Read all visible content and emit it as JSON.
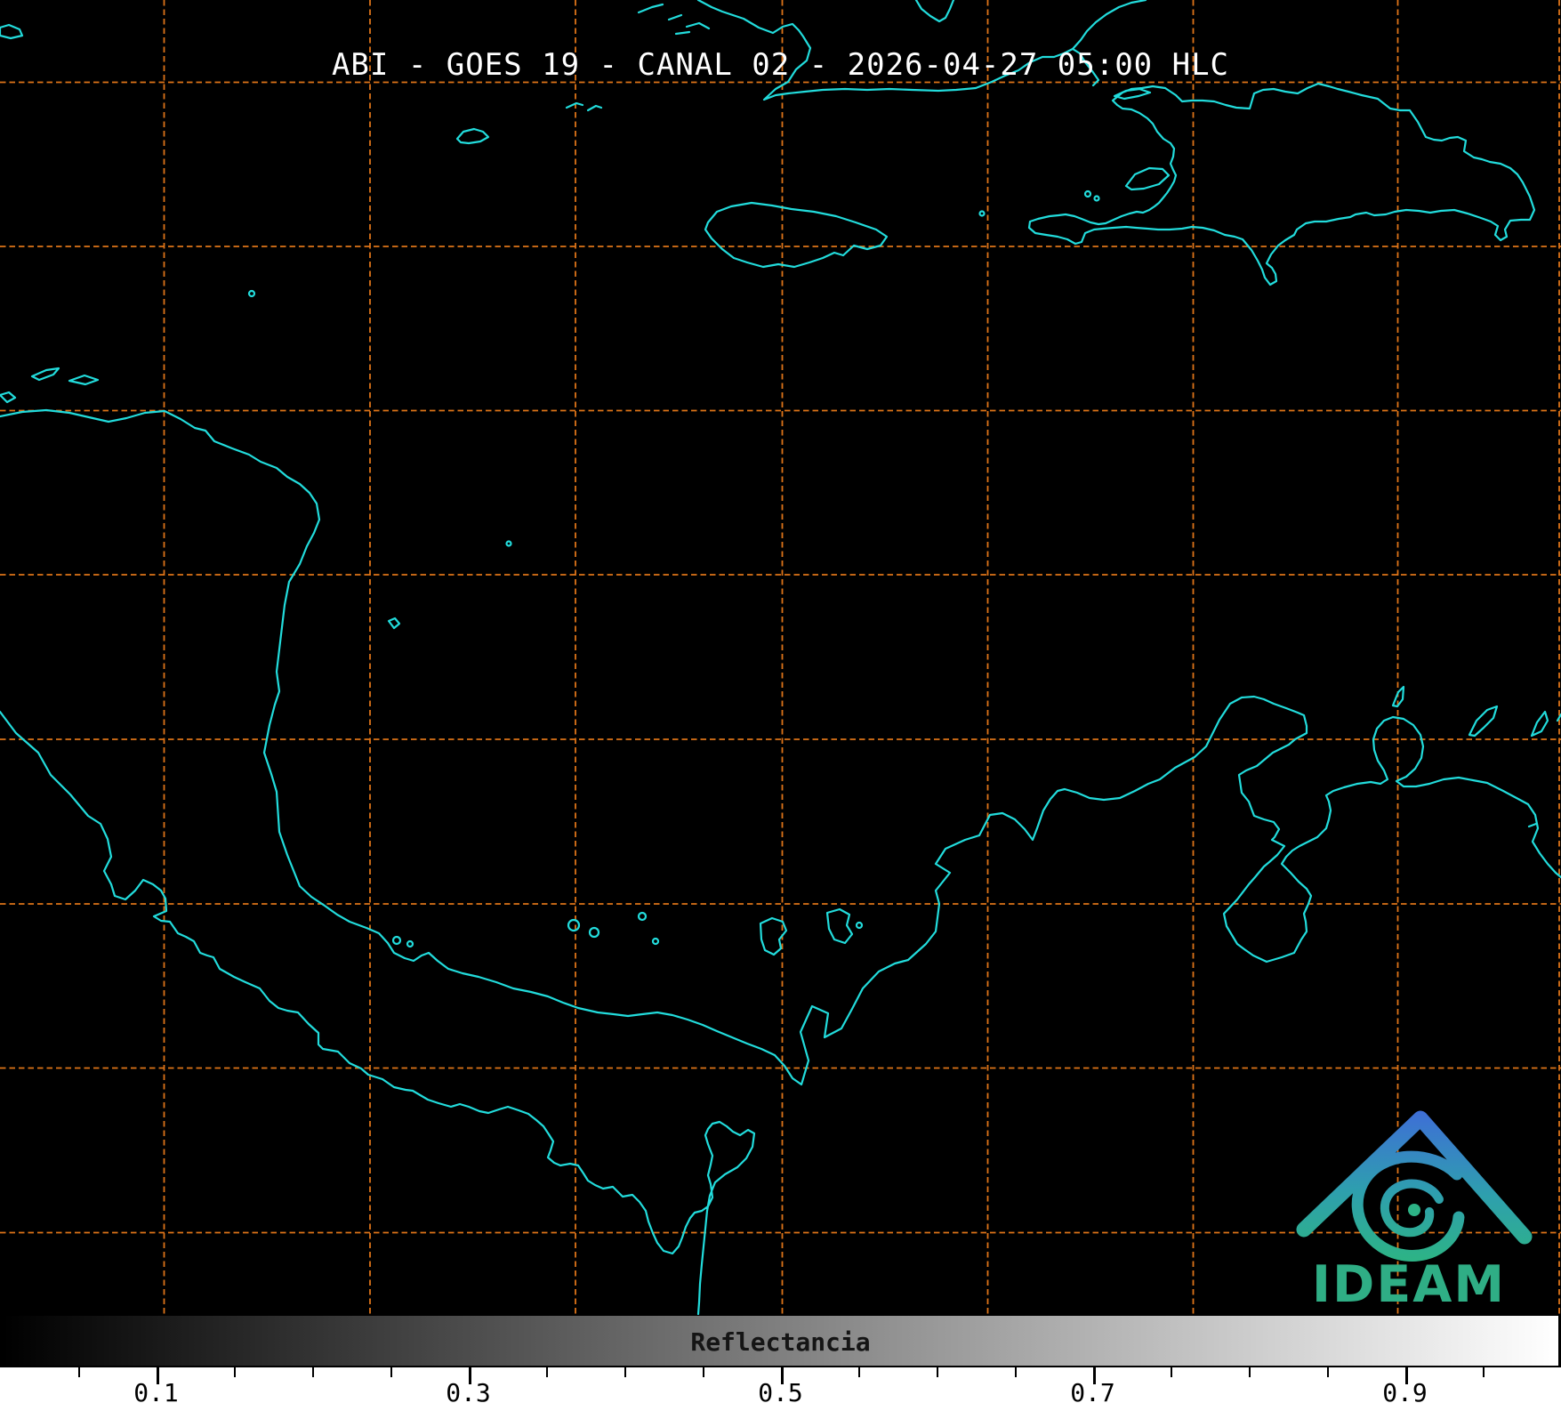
{
  "title": {
    "text": "ABI - GOES 19 - CANAL 02 - 2026-04-27 05:00 HLC",
    "instrument": "ABI",
    "satellite": "GOES 19",
    "channel": "CANAL 02",
    "datetime": "2026-04-27 05:00 HLC"
  },
  "colorbar": {
    "label": "Reflectancia",
    "tick_labels": [
      "0.1",
      "0.3",
      "0.5",
      "0.7",
      "0.9"
    ],
    "minor_tick_step": 0.05,
    "range_min": 0,
    "range_max": 1,
    "gradient_start": "#000000",
    "gradient_end": "#ffffff"
  },
  "logo": {
    "text": "IDEAM",
    "text_color": "#2fae85",
    "top_color": "#3e6fd6",
    "bottom_color": "#2db386"
  },
  "map": {
    "background": "#000000",
    "coastline_color": "#22dcdc",
    "grid_color": "#de7418"
  }
}
